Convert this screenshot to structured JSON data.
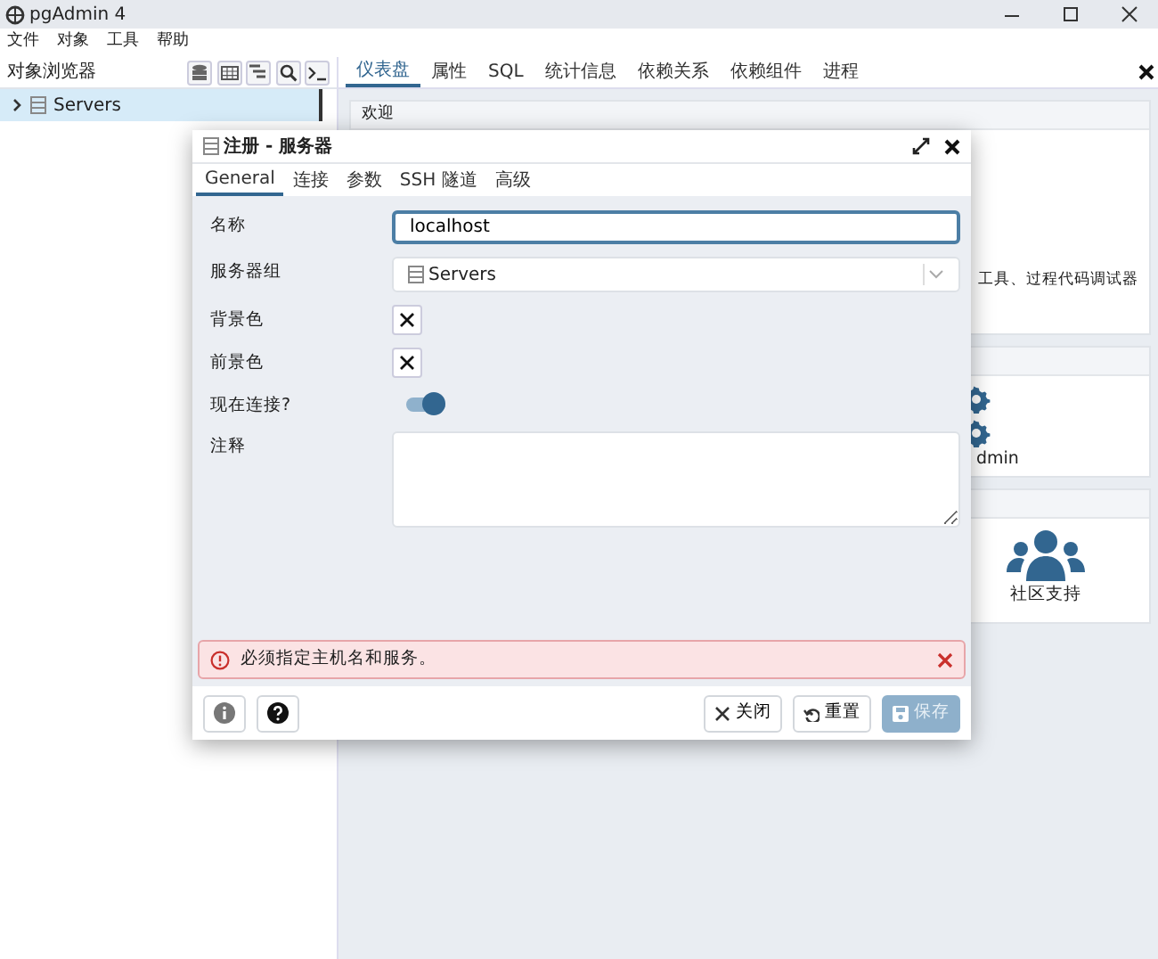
{
  "window": {
    "title": "pgAdmin 4"
  },
  "menu": [
    "文件",
    "对象",
    "工具",
    "帮助"
  ],
  "browser": {
    "title": "对象浏览器",
    "tree": [
      {
        "label": "Servers",
        "expanded": false,
        "selected": true
      }
    ]
  },
  "tabs": [
    {
      "label": "仪表盘",
      "selected": true
    },
    {
      "label": "属性",
      "selected": false
    },
    {
      "label": "SQL",
      "selected": false
    },
    {
      "label": "统计信息",
      "selected": false
    },
    {
      "label": "依赖关系",
      "selected": false
    },
    {
      "label": "依赖组件",
      "selected": false
    },
    {
      "label": "进程",
      "selected": false
    }
  ],
  "dashboard": {
    "welcome_title": "欢迎",
    "welcome_text": "工具、过程代码调试器",
    "admin_label": "dmin",
    "community_label": "社区支持"
  },
  "dialog": {
    "title": "注册 - 服务器",
    "tabs": [
      {
        "label": "General",
        "selected": true
      },
      {
        "label": "连接",
        "selected": false
      },
      {
        "label": "参数",
        "selected": false
      },
      {
        "label": "SSH 隧道",
        "selected": false
      },
      {
        "label": "高级",
        "selected": false
      }
    ],
    "fields": [
      {
        "kind": "text",
        "label": "名称",
        "value": "localhost",
        "focused": true
      },
      {
        "kind": "select",
        "label": "服务器组",
        "value": "Servers"
      },
      {
        "kind": "color",
        "label": "背景色"
      },
      {
        "kind": "color",
        "label": "前景色"
      },
      {
        "kind": "switch",
        "label": "现在连接?",
        "on": true
      },
      {
        "kind": "textarea",
        "label": "注释"
      }
    ],
    "error": "必须指定主机名和服务。",
    "buttons": [
      {
        "kind": "close",
        "label": "关闭",
        "disabled": false
      },
      {
        "kind": "reset",
        "label": "重置",
        "disabled": false
      },
      {
        "kind": "save",
        "label": "保存",
        "disabled": true
      }
    ]
  }
}
